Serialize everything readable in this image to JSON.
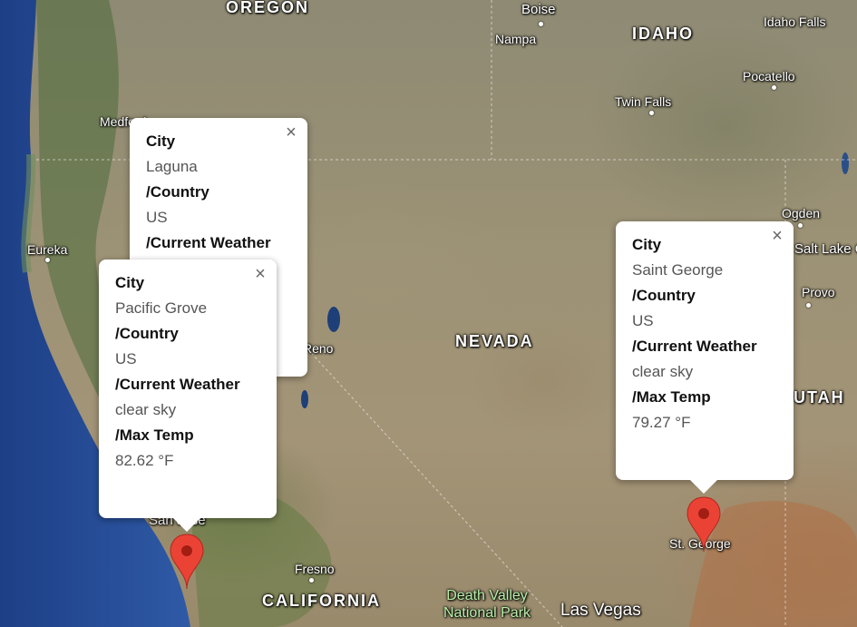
{
  "map": {
    "places": [
      {
        "name": "OREGON",
        "kind": "state"
      },
      {
        "name": "IDAHO",
        "kind": "state"
      },
      {
        "name": "NEVADA",
        "kind": "state"
      },
      {
        "name": "UTAH",
        "kind": "state"
      },
      {
        "name": "CALIFORNIA",
        "kind": "state"
      },
      {
        "name": "Boise",
        "kind": "city"
      },
      {
        "name": "Nampa",
        "kind": "city"
      },
      {
        "name": "Idaho Falls",
        "kind": "city"
      },
      {
        "name": "Pocatello",
        "kind": "city"
      },
      {
        "name": "Twin Falls",
        "kind": "city"
      },
      {
        "name": "Ogden",
        "kind": "city"
      },
      {
        "name": "Salt Lake City",
        "kind": "city"
      },
      {
        "name": "Provo",
        "kind": "city"
      },
      {
        "name": "Medford",
        "kind": "city"
      },
      {
        "name": "Eureka",
        "kind": "city"
      },
      {
        "name": "Reno",
        "kind": "city"
      },
      {
        "name": "San Jose",
        "kind": "city"
      },
      {
        "name": "Fresno",
        "kind": "city"
      },
      {
        "name": "St. George",
        "kind": "city"
      },
      {
        "name": "Las Vegas",
        "kind": "city"
      },
      {
        "name": "Death Valley National Park",
        "kind": "park"
      }
    ]
  },
  "popups": [
    {
      "city_label": "City",
      "city": "Laguna",
      "country_label": "/Country",
      "country": "US",
      "weather_label": "/Current Weather"
    },
    {
      "city_label": "City",
      "city": "Pacific Grove",
      "country_label": "/Country",
      "country": "US",
      "weather_label": "/Current Weather",
      "weather": "clear sky",
      "temp_label": "/Max Temp",
      "temp": "82.62 °F"
    },
    {
      "city_label": "City",
      "city": "Saint George",
      "country_label": "/Country",
      "country": "US",
      "weather_label": "/Current Weather",
      "weather": "clear sky",
      "temp_label": "/Max Temp",
      "temp": "79.27 °F"
    }
  ],
  "close_glyph": "×",
  "marker_color": "#ea4335",
  "marker_icon": "map-pin-icon",
  "close_icon": "close-icon"
}
